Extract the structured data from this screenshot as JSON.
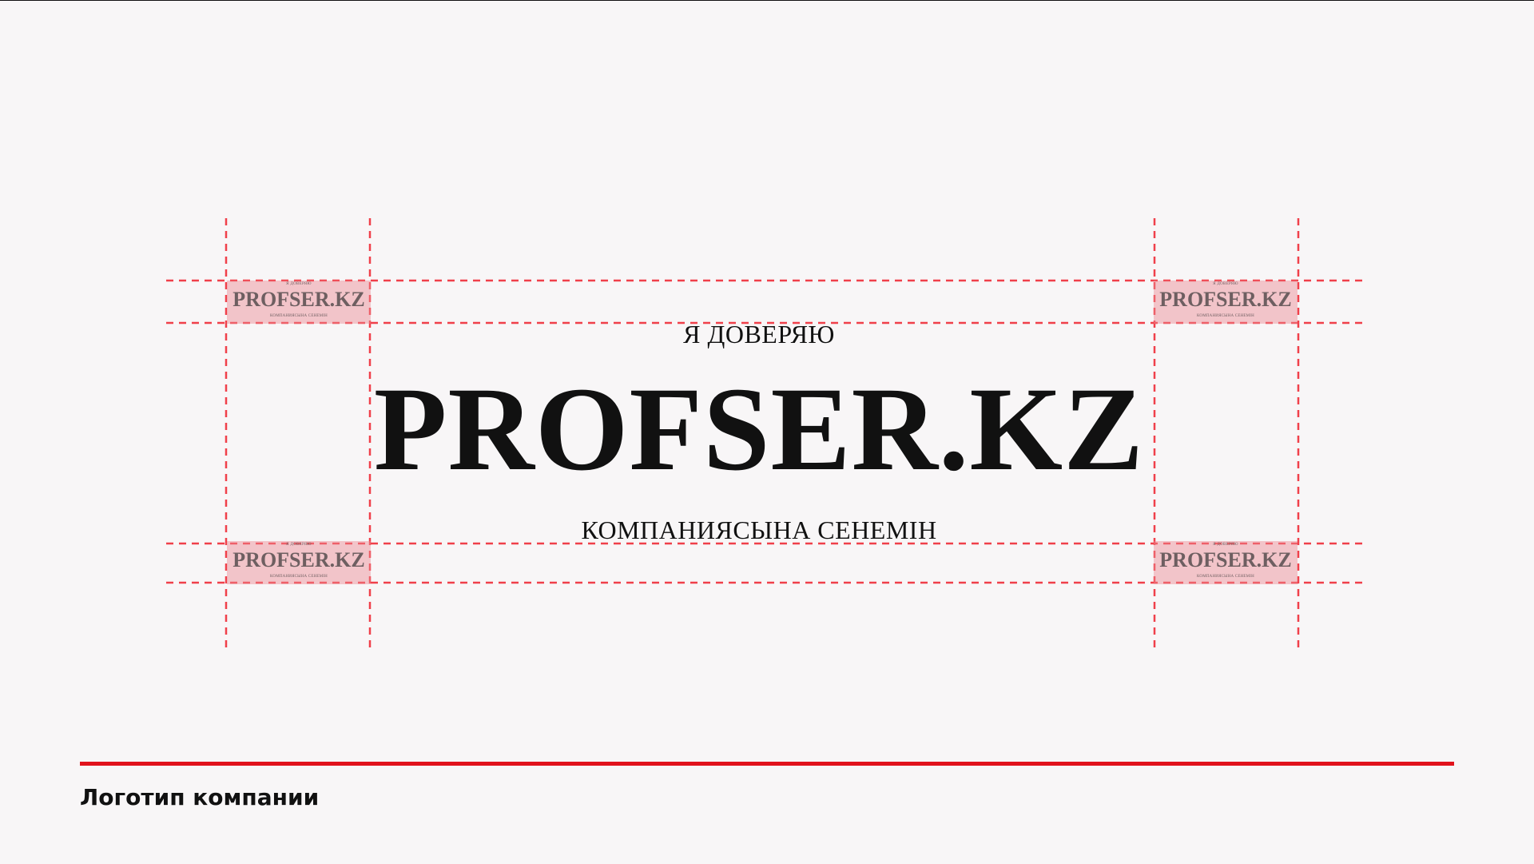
{
  "logo": {
    "top_text": "Я ДОВЕРЯЮ",
    "main_text": "PROFSER.KZ",
    "bottom_text": "КОМПАНИЯСЫНА СЕНЕМІН"
  },
  "footer": {
    "caption": "Логотип компании"
  },
  "colors": {
    "guide_red": "#f0404a",
    "accent_red": "#e1131c",
    "mini_logo_fill": "#ec8890",
    "background": "#f8f6f7"
  }
}
